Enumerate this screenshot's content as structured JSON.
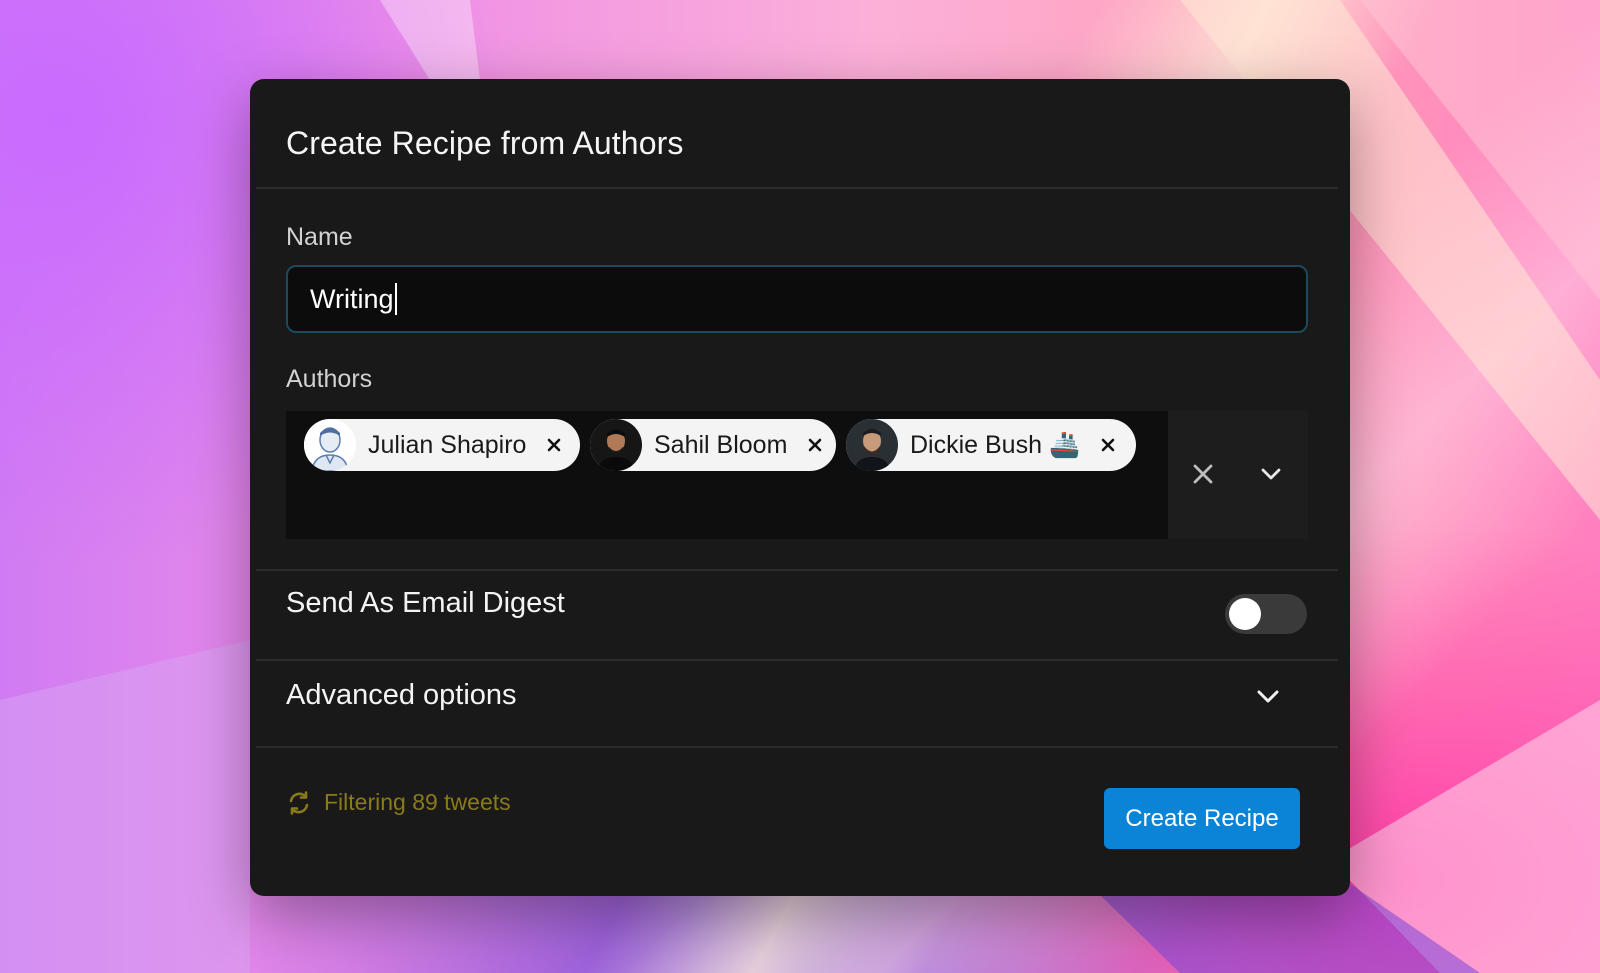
{
  "dialog": {
    "title": "Create Recipe from Authors"
  },
  "name_field": {
    "label": "Name",
    "value": "Writing"
  },
  "authors_field": {
    "label": "Authors",
    "selected": [
      {
        "name": "Julian Shapiro",
        "avatar_icon": "julian-shapiro-avatar"
      },
      {
        "name": "Sahil Bloom",
        "avatar_icon": "sahil-bloom-avatar"
      },
      {
        "name": "Dickie Bush 🚢",
        "avatar_icon": "dickie-bush-avatar"
      }
    ],
    "clear_icon": "clear-all-icon",
    "dropdown_icon": "chevron-down-icon"
  },
  "email_digest": {
    "label": "Send As Email Digest",
    "enabled": false
  },
  "advanced": {
    "label": "Advanced options",
    "expanded": false
  },
  "footer": {
    "status_text": "Filtering 89 tweets",
    "status_icon": "refresh-icon",
    "create_label": "Create Recipe"
  },
  "colors": {
    "accent": "#0a84d6",
    "status": "#8a7a1a",
    "dialog_bg": "#191919"
  }
}
